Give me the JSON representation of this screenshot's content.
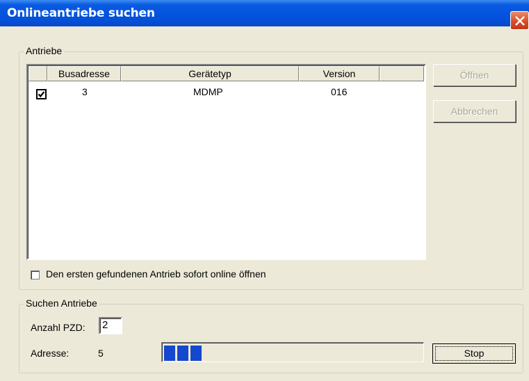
{
  "window": {
    "title": "Onlineantriebe suchen"
  },
  "antriebe_group": {
    "label": "Antriebe",
    "columns": [
      "",
      "Busadresse",
      "Gerätetyp",
      "Version",
      ""
    ],
    "rows": [
      {
        "checked": true,
        "busadresse": "3",
        "geraetetyp": "MDMP",
        "version": "016"
      }
    ],
    "open_checkbox_label": "Den ersten gefundenen Antrieb sofort online öffnen",
    "open_checkbox_checked": false
  },
  "buttons": {
    "open": "Öffnen",
    "cancel": "Abbrechen",
    "stop": "Stop"
  },
  "search_group": {
    "label": "Suchen Antriebe",
    "pzd_label": "Anzahl PZD:",
    "pzd_value": "2",
    "address_label": "Adresse:",
    "address_value": "5",
    "progress_fraction": 0.15
  },
  "colors": {
    "title_bar": "#0454de",
    "progress": "#1448ce",
    "close_button": "#d74a25"
  }
}
